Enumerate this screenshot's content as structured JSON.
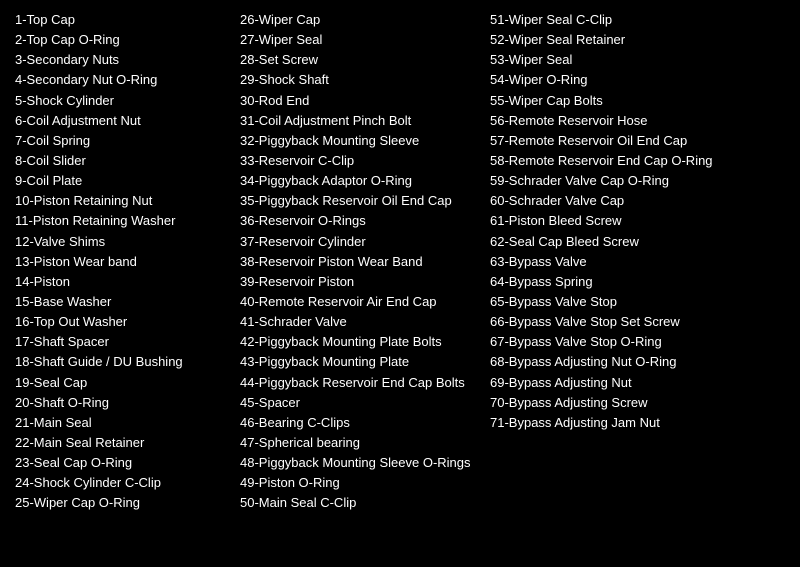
{
  "columns": [
    {
      "id": "col1",
      "items": [
        "1-Top Cap",
        "2-Top Cap O-Ring",
        "3-Secondary Nuts",
        "4-Secondary Nut O-Ring",
        "5-Shock Cylinder",
        "6-Coil Adjustment Nut",
        "7-Coil Spring",
        "8-Coil Slider",
        "9-Coil Plate",
        "10-Piston Retaining Nut",
        "11-Piston Retaining Washer",
        "12-Valve Shims",
        "13-Piston Wear band",
        "14-Piston",
        "15-Base Washer",
        "16-Top Out Washer",
        "17-Shaft Spacer",
        "18-Shaft Guide / DU Bushing",
        "19-Seal Cap",
        "20-Shaft O-Ring",
        "21-Main Seal",
        "22-Main Seal Retainer",
        "23-Seal Cap O-Ring",
        "24-Shock Cylinder C-Clip",
        "25-Wiper Cap O-Ring"
      ]
    },
    {
      "id": "col2",
      "items": [
        "26-Wiper Cap",
        "27-Wiper Seal",
        "28-Set Screw",
        "29-Shock Shaft",
        "30-Rod End",
        "31-Coil Adjustment Pinch Bolt",
        "32-Piggyback Mounting Sleeve",
        "33-Reservoir C-Clip",
        "34-Piggyback Adaptor O-Ring",
        "35-Piggyback Reservoir Oil End Cap",
        "36-Reservoir O-Rings",
        "37-Reservoir Cylinder",
        "38-Reservoir Piston Wear Band",
        "39-Reservoir Piston",
        "40-Remote Reservoir Air End Cap",
        "41-Schrader Valve",
        "42-Piggyback Mounting Plate Bolts",
        "43-Piggyback Mounting Plate",
        "44-Piggyback Reservoir End Cap Bolts",
        "45-Spacer",
        "46-Bearing C-Clips",
        "47-Spherical bearing",
        "48-Piggyback Mounting Sleeve O-Rings",
        "49-Piston O-Ring",
        "50-Main Seal C-Clip"
      ]
    },
    {
      "id": "col3",
      "items": [
        "51-Wiper Seal C-Clip",
        "52-Wiper Seal Retainer",
        "53-Wiper Seal",
        "54-Wiper O-Ring",
        "55-Wiper Cap Bolts",
        "56-Remote Reservoir Hose",
        "57-Remote Reservoir Oil End Cap",
        "58-Remote Reservoir End Cap O-Ring",
        "59-Schrader Valve Cap O-Ring",
        "60-Schrader Valve Cap",
        "61-Piston Bleed Screw",
        "62-Seal Cap Bleed Screw",
        "63-Bypass Valve",
        "64-Bypass Spring",
        "65-Bypass Valve Stop",
        "66-Bypass Valve Stop Set Screw",
        "67-Bypass Valve Stop O-Ring",
        "68-Bypass Adjusting Nut O-Ring",
        "69-Bypass Adjusting Nut",
        "70-Bypass Adjusting Screw",
        "71-Bypass Adjusting Jam Nut"
      ]
    }
  ]
}
